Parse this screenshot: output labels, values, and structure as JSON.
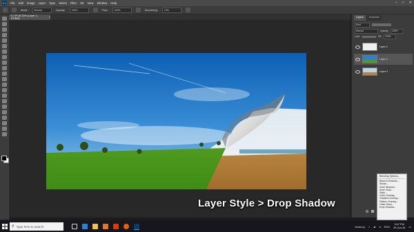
{
  "app": {
    "logo": "Ps",
    "menu": [
      "File",
      "Edit",
      "Image",
      "Layer",
      "Type",
      "Select",
      "Filter",
      "3D",
      "View",
      "Window",
      "Help"
    ],
    "window_controls": [
      "–",
      "□",
      "✕"
    ]
  },
  "options_bar": {
    "mode_label": "Mode:",
    "mode_value": "Normal",
    "opacity_label": "Opacity:",
    "opacity_value": "100%",
    "flow_label": "Flow:",
    "flow_value": "100%",
    "smoothing_label": "Smoothing:",
    "smoothing_value": "10%"
  },
  "document": {
    "tab_label": "K.TIF @ 33% (Layer 1, RGB/8)",
    "tab_close": "×"
  },
  "panel": {
    "tabs": [
      "Layers",
      "Channels"
    ],
    "kind_label": "Kind",
    "blend_mode": "Normal",
    "opacity_label": "Opacity:",
    "opacity_value": "100%",
    "lock_label": "Lock:",
    "fill_label": "Fill:",
    "fill_value": "100%",
    "layers": [
      {
        "name": "Layer 2",
        "selected": false
      },
      {
        "name": "Layer 1",
        "selected": true
      },
      {
        "name": "Layer 0",
        "selected": false
      }
    ]
  },
  "context_menu": {
    "items": [
      "Blending Options...",
      "Bevel & Emboss...",
      "Stroke...",
      "Inner Shadow...",
      "Inner Glow...",
      "Satin...",
      "Color Overlay...",
      "Gradient Overlay...",
      "Pattern Overlay...",
      "Outer Glow...",
      "Drop Shadow..."
    ]
  },
  "caption": "Layer Style > Drop Shadow",
  "taskbar": {
    "search_placeholder": "Type here to search",
    "tray_desktop": "Desktop",
    "tray_lang": "ENG",
    "time": "5:47 PM",
    "date": "29-Jun-18"
  },
  "colors": {
    "menubar": "#4a4a4a",
    "panel": "#3c3c3c",
    "workspace": "#282828",
    "accent": "#31a8ff"
  }
}
